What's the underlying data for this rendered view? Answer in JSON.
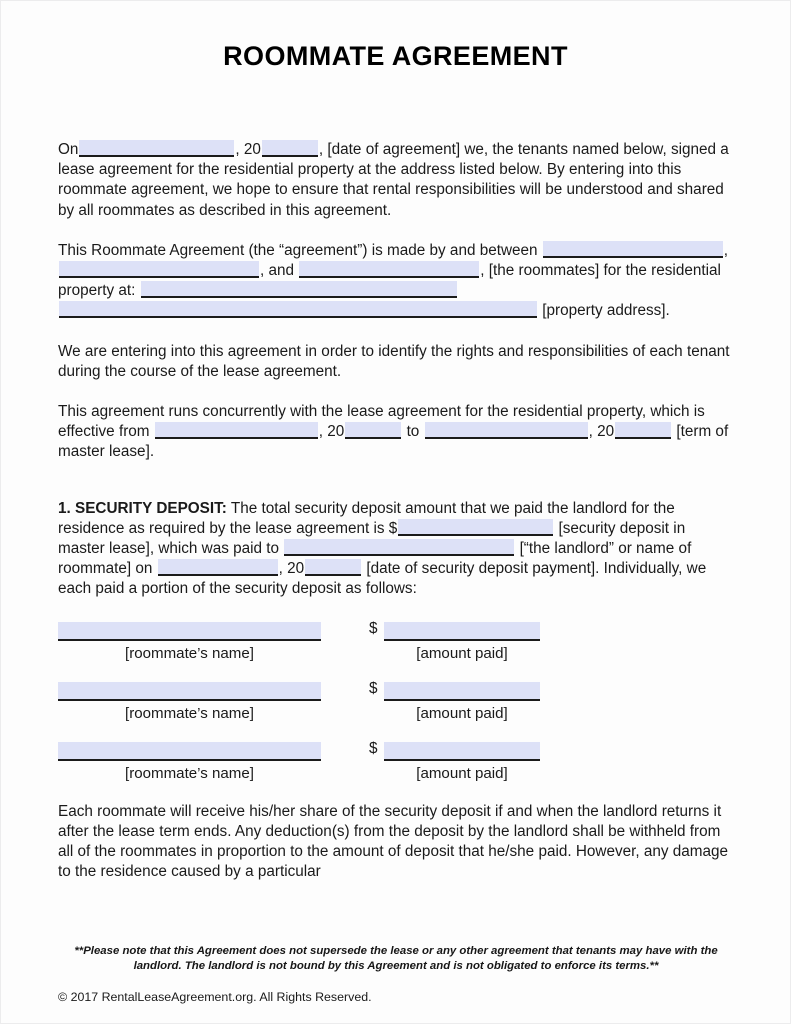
{
  "document": {
    "title": "ROOMMATE AGREEMENT"
  },
  "paragraphs": {
    "intro": {
      "seg1": "On",
      "seg2": ", 20",
      "seg3": ", [date of agreement] we, the tenants named below, signed a lease agreement for the residential property at the address listed below. By entering into this roommate agreement, we hope to ensure that rental responsibilities will be understood and shared by all roommates as described in this agreement."
    },
    "parties": {
      "seg1": "This Roommate Agreement (the “agreement”) is made by and between",
      "seg2": ",",
      "seg3": ", and",
      "seg4": ", [the roommates] for the residential property at:",
      "seg5": "[property address]."
    },
    "purpose": {
      "text": "We are entering into this agreement in order to identify the rights and responsibilities of each tenant during the course of the lease agreement."
    },
    "term": {
      "seg1": "This agreement runs concurrently with the lease agreement for the residential property, which is effective from",
      "seg2": ", 20",
      "seg3": "to",
      "seg4": ", 20",
      "seg5": "[term of master lease]."
    }
  },
  "sections": {
    "security_deposit": {
      "number": "1.",
      "heading": "SECURITY DEPOSIT:",
      "seg1": "The total security deposit amount that we paid the landlord for the residence as required by the lease agreement is $",
      "seg2": "[security deposit in master lease], which was paid to",
      "seg3": "[“the landlord” or name of roommate] on",
      "seg4": ", 20",
      "seg5": "[date of security deposit payment]. Individually, we each paid a portion of the security deposit as follows:",
      "rows": [
        {
          "name_caption": "[roommate’s name]",
          "currency_symbol": "$",
          "amount_caption": "[amount paid]"
        },
        {
          "name_caption": "[roommate’s name]",
          "currency_symbol": "$",
          "amount_caption": "[amount paid]"
        },
        {
          "name_caption": "[roommate’s name]",
          "currency_symbol": "$",
          "amount_caption": "[amount paid]"
        }
      ],
      "closing": "Each roommate will receive his/her share of the security deposit if and when the landlord returns it after the lease term ends. Any deduction(s) from the deposit by the landlord shall be withheld from all of the roommates in proportion to the amount of deposit that he/she paid. However, any damage to the residence caused by a particular"
    }
  },
  "footer": {
    "note": "**Please note that this Agreement does not supersede the lease or any other agreement that tenants may have with the landlord. The landlord is not bound by this Agreement and is not obligated to enforce its terms.**",
    "copyright": "© 2017 RentalLeaseAgreement.org. All Rights Reserved."
  },
  "colors": {
    "field_fill": "#dde1f7",
    "field_underline": "#1b1b1b",
    "text": "#1a1a1a",
    "page_background": "#fdfdfd"
  }
}
